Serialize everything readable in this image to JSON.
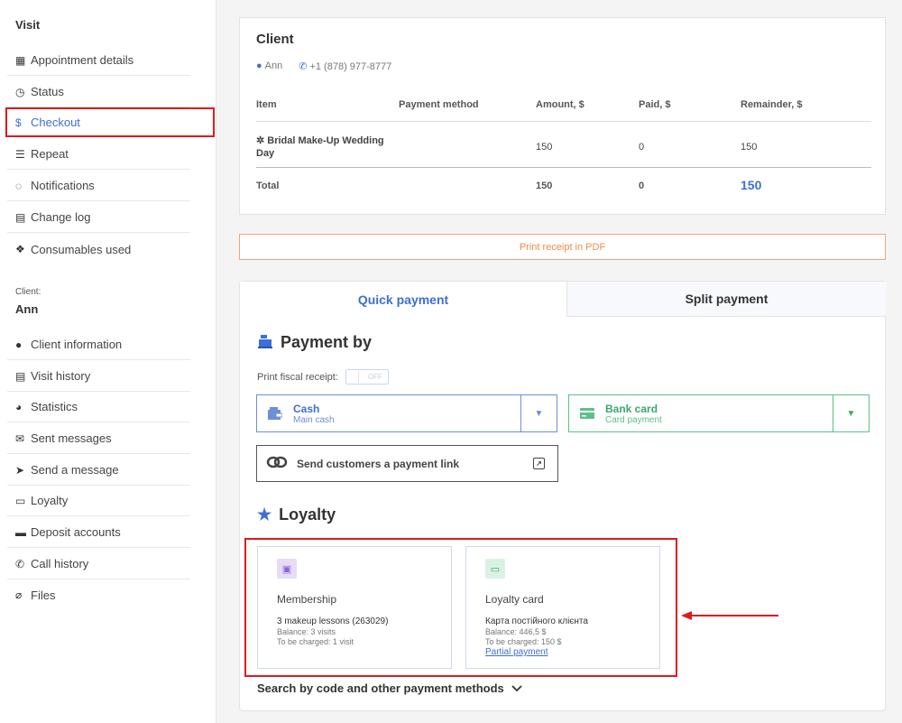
{
  "sidebar": {
    "visit_title": "Visit",
    "visit_items": [
      {
        "label": "Appointment details",
        "icon": "calendar-icon"
      },
      {
        "label": "Status",
        "icon": "clock-icon"
      },
      {
        "label": "Checkout",
        "icon": "dollar-icon"
      },
      {
        "label": "Repeat",
        "icon": "list-icon"
      },
      {
        "label": "Notifications",
        "icon": "chat-icon"
      },
      {
        "label": "Change log",
        "icon": "file-icon"
      },
      {
        "label": "Consumables used",
        "icon": "cubes-icon"
      }
    ],
    "client_label": "Client:",
    "client_name": "Ann",
    "client_items": [
      {
        "label": "Client information",
        "icon": "user-icon"
      },
      {
        "label": "Visit history",
        "icon": "list-box-icon"
      },
      {
        "label": "Statistics",
        "icon": "pie-chart-icon"
      },
      {
        "label": "Sent messages",
        "icon": "envelope-icon"
      },
      {
        "label": "Send a message",
        "icon": "paper-plane-icon"
      },
      {
        "label": "Loyalty",
        "icon": "card-icon"
      },
      {
        "label": "Deposit accounts",
        "icon": "briefcase-icon"
      },
      {
        "label": "Call history",
        "icon": "phone-icon"
      },
      {
        "label": "Files",
        "icon": "paperclip-icon"
      }
    ]
  },
  "client": {
    "title": "Client",
    "name": "Ann",
    "phone": "+1 (878) 977-8777",
    "table": {
      "headers": [
        "Item",
        "Payment method",
        "Amount, $",
        "Paid, $",
        "Remainder, $"
      ],
      "rows": [
        {
          "item": "Bridal Make-Up Wedding Day",
          "payment_method": "",
          "amount": "150",
          "paid": "0",
          "remainder": "150"
        }
      ],
      "total": {
        "label": "Total",
        "amount": "150",
        "paid": "0",
        "remainder": "150"
      }
    }
  },
  "print_receipt_label": "Print receipt in PDF",
  "payment": {
    "tabs": [
      "Quick payment",
      "Split payment"
    ],
    "payment_by_title": "Payment by",
    "fiscal_label": "Print fiscal receipt:",
    "fiscal_toggle": "OFF",
    "cash": {
      "title": "Cash",
      "subtitle": "Main cash"
    },
    "bank_card": {
      "title": "Bank card",
      "subtitle": "Card payment"
    },
    "payment_link_label": "Send customers a payment link",
    "loyalty_title": "Loyalty",
    "membership": {
      "name": "Membership",
      "line1": "3 makeup lessons (263029)",
      "line2": "Balance: 3 visits",
      "line3": "To be charged: 1 visit"
    },
    "loyalty_card": {
      "name": "Loyalty card",
      "line1": "Карта постійного клієнта",
      "line2": "Balance: 446,5 $",
      "line3": "To be charged: 150 $",
      "link": "Partial payment"
    },
    "search_more_label": "Search by code and other payment methods"
  },
  "colors": {
    "accent": "#3d6fd6",
    "green": "#3aa86d",
    "highlight": "#e0191e",
    "orange": "#f08a4b"
  }
}
